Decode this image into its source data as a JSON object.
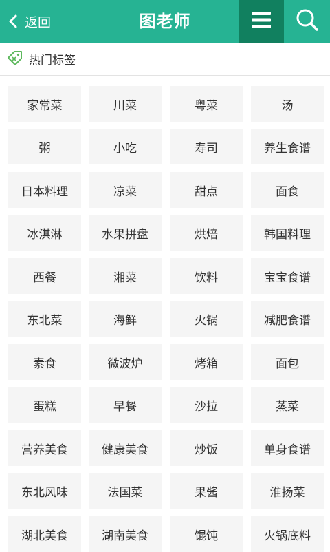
{
  "header": {
    "back_label": "返回",
    "title": "图老师",
    "background_color": "#26b393",
    "menu_active_color": "#11805f",
    "icons": [
      "chevron-left-icon",
      "menu-icon",
      "search-icon"
    ]
  },
  "section": {
    "title": "热门标签",
    "icon": "tag-icon"
  },
  "tags": [
    "家常菜",
    "川菜",
    "粤菜",
    "汤",
    "粥",
    "小吃",
    "寿司",
    "养生食谱",
    "日本料理",
    "凉菜",
    "甜点",
    "面食",
    "冰淇淋",
    "水果拼盘",
    "烘焙",
    "韩国料理",
    "西餐",
    "湘菜",
    "饮料",
    "宝宝食谱",
    "东北菜",
    "海鲜",
    "火锅",
    "减肥食谱",
    "素食",
    "微波炉",
    "烤箱",
    "面包",
    "蛋糕",
    "早餐",
    "沙拉",
    "蒸菜",
    "营养美食",
    "健康美食",
    "炒饭",
    "单身食谱",
    "东北风味",
    "法国菜",
    "果酱",
    "淮扬菜",
    "湖北美食",
    "湖南美食",
    "馄饨",
    "火锅底料"
  ]
}
